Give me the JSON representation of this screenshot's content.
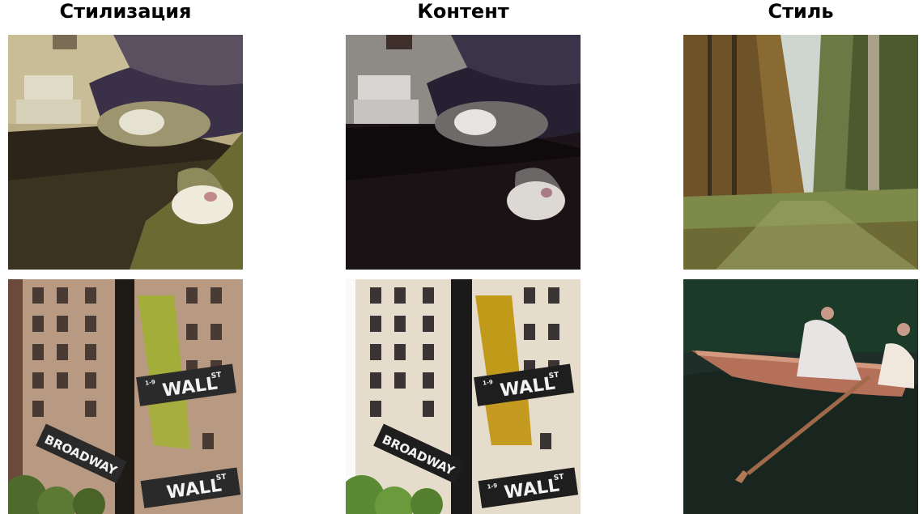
{
  "columns": [
    {
      "title": "Стилизация"
    },
    {
      "title": "Контент"
    },
    {
      "title": "Стиль"
    }
  ],
  "signs": {
    "wall_street": "WALL",
    "street_suffix": "ST",
    "broadway": "BROADWAY",
    "block_number": "1-9"
  }
}
